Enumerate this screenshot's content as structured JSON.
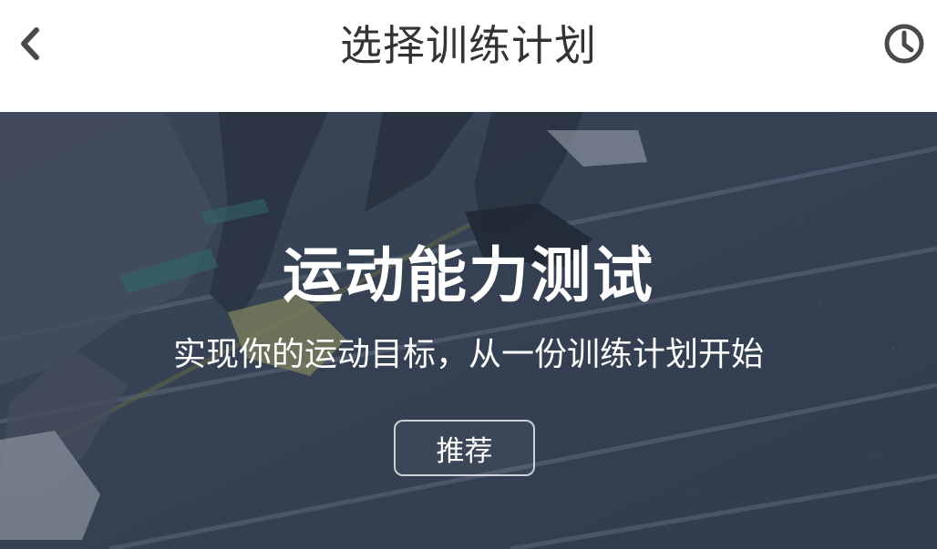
{
  "header": {
    "title": "选择训练计划",
    "back_icon": "chevron-left-icon",
    "history_icon": "clock-icon"
  },
  "banner": {
    "heading": "运动能力测试",
    "subtitle": "实现你的运动目标，从一份训练计划开始",
    "button_label": "推荐",
    "image": "sprinters-at-starting-line-on-track"
  },
  "colors": {
    "title_text": "#333333",
    "icon": "#4a4a4a",
    "banner_overlay": "#263244",
    "banner_text": "#ffffff"
  }
}
